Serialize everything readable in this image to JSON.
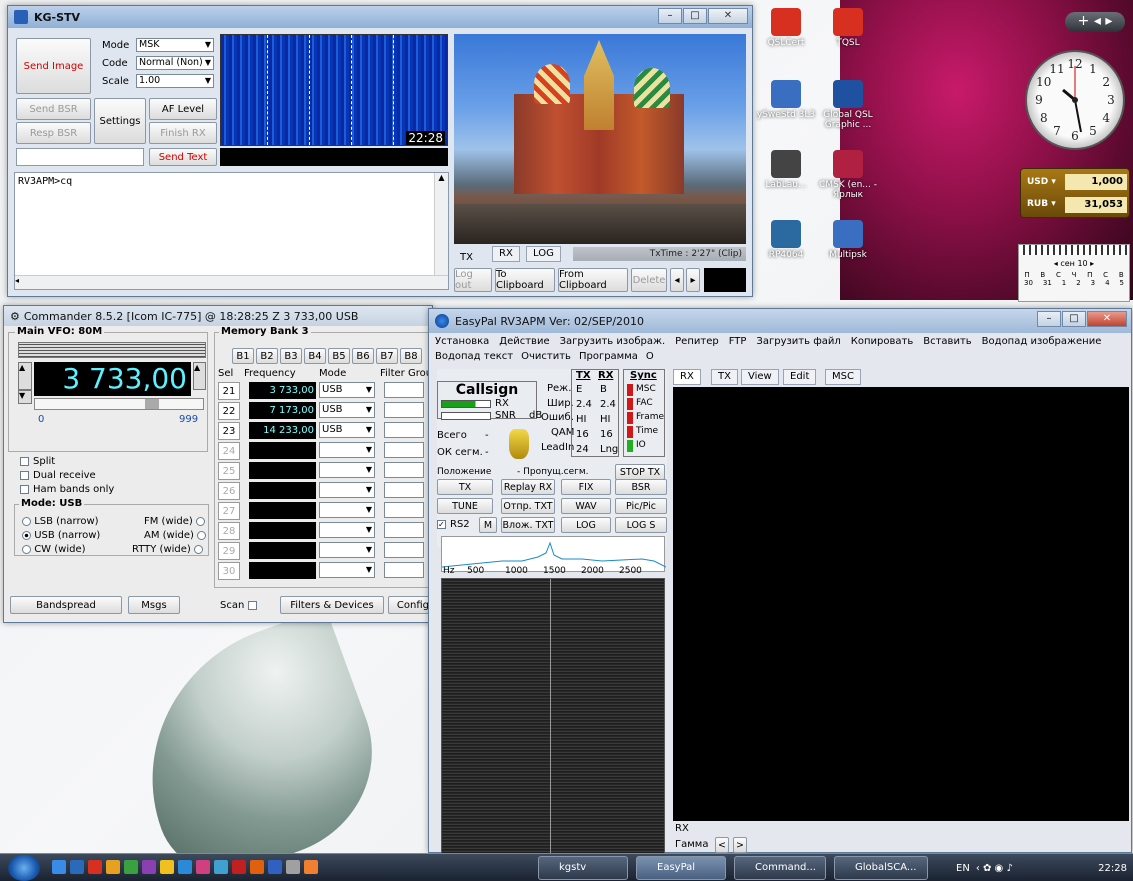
{
  "kgstv": {
    "title": "KG-STV",
    "send_image": "Send Image",
    "mode_label": "Mode",
    "mode_value": "MSK",
    "code_label": "Code",
    "code_value": "Normal (Non)",
    "scale_label": "Scale",
    "scale_value": "1.00",
    "send_bsr": "Send BSR",
    "resp_bsr": "Resp BSR",
    "settings": "Settings",
    "af_level": "AF Level",
    "finish_rx": "Finish RX",
    "send_text": "Send Text",
    "waterfall_time": "22:28",
    "text_content": "RV3APM>cq",
    "tab_tx": "TX",
    "tab_rx": "RX",
    "tab_log": "LOG",
    "txtime": "TxTime : 2'27\" (Clip)",
    "log_out": "Log out",
    "to_clipboard": "To Clipboard",
    "from_clipboard": "From Clipboard",
    "delete": "Delete"
  },
  "commander": {
    "title": "Commander 8.5.2 [Icom IC-775] @ 18:28:25 Z  3 733,00 USB",
    "main_vfo": "Main VFO: 80M",
    "frequency": "3 733,00",
    "slider_min": "0",
    "slider_max": "999",
    "split": "Split",
    "dual_receive": "Dual receive",
    "ham_bands_only": "Ham bands only",
    "mode_title": "Mode: USB",
    "lsb": "LSB (narrow)",
    "usb": "USB (narrow)",
    "cw": "CW (wide)",
    "fm": "FM (wide)",
    "am": "AM (wide)",
    "rtty": "RTTY (wide)",
    "memory_bank": "Memory Bank 3",
    "banks": [
      "B1",
      "B2",
      "B3",
      "B4",
      "B5",
      "B6",
      "B7",
      "B8"
    ],
    "col_sel": "Sel",
    "col_freq": "Frequency",
    "col_mode": "Mode",
    "col_fg": "Filter Group",
    "rows": [
      {
        "sel": "21",
        "freq": "3 733,00",
        "mode": "USB"
      },
      {
        "sel": "22",
        "freq": "7 173,00",
        "mode": "USB"
      },
      {
        "sel": "23",
        "freq": "14 233,00",
        "mode": "USB"
      },
      {
        "sel": "24",
        "freq": "",
        "mode": ""
      },
      {
        "sel": "25",
        "freq": "",
        "mode": ""
      },
      {
        "sel": "26",
        "freq": "",
        "mode": ""
      },
      {
        "sel": "27",
        "freq": "",
        "mode": ""
      },
      {
        "sel": "28",
        "freq": "",
        "mode": ""
      },
      {
        "sel": "29",
        "freq": "",
        "mode": ""
      },
      {
        "sel": "30",
        "freq": "",
        "mode": ""
      }
    ],
    "bandspread": "Bandspread",
    "msgs": "Msgs",
    "scan": "Scan",
    "filters_devices": "Filters & Devices",
    "config": "Config"
  },
  "easypal": {
    "title": "EasyPal  RV3APM  Ver: 02/SEP/2010",
    "menu": [
      "Установка",
      "Действие",
      "Загрузить изображ.",
      "Репитер",
      "FTP",
      "Загрузить файл",
      "Копировать",
      "Вставить",
      "Водопад изображение"
    ],
    "menu2": [
      "Водопад текст",
      "Очистить",
      "Программа",
      "О"
    ],
    "callsign": "Callsign",
    "rx": "RX",
    "snr": "SNR",
    "db": "dB",
    "rez": "Реж.",
    "shir": "Шир.",
    "oshib": "Ошиб.",
    "qam": "QAM",
    "leadin": "LeadIn",
    "col_tx": "TX",
    "col_rx": "RX",
    "vals_tx": [
      "E",
      "2.4",
      "HI",
      "16",
      "24"
    ],
    "vals_rx": [
      "B",
      "2.4",
      "HI",
      "16",
      "Lng"
    ],
    "sync": "Sync",
    "sync_items": [
      "MSC",
      "FAC",
      "Frame",
      "Time",
      "IO"
    ],
    "vsego": "Всего",
    "ok_segm": "ОК сегм.",
    "dash": "-",
    "polozhenie": "Положение",
    "propusch": "- Пропущ.сегм.",
    "stop_tx": "STOP TX",
    "b_tx": "TX",
    "b_replay": "Replay RX",
    "b_fix": "FIX",
    "b_bsr": "BSR",
    "b_tune": "TUNE",
    "b_otpr": "Отпр. TXT",
    "b_wav": "WAV",
    "b_picpic": "Pic/Pic",
    "b_rs2": "RS2",
    "b_m": "M",
    "b_vlozh": "Влож. TXT",
    "b_log": "LOG",
    "b_logs": "LOG S",
    "spec_hz": "Hz",
    "spec_ticks": [
      "500",
      "1000",
      "1500",
      "2000",
      "2500"
    ],
    "tabs": [
      "RX",
      "TX",
      "View",
      "Edit",
      "MSC"
    ],
    "status_rx": "RX",
    "gamma": "Гамма"
  },
  "desktop": {
    "icons": [
      {
        "label": "QSLCert",
        "color": "#d83020"
      },
      {
        "label": "TQSL",
        "color": "#d83020"
      },
      {
        "label": "ySweStd 3L3",
        "color": "#3a6ec0"
      },
      {
        "label": "Global QSL Graphic ...",
        "color": "#2050a0"
      },
      {
        "label": "LabLau...",
        "color": "#444444"
      },
      {
        "label": "CMSK (en... - Ярлык",
        "color": "#b02040"
      },
      {
        "label": "RP4064",
        "color": "#2a6aa0"
      },
      {
        "label": "Multipsk",
        "color": "#3a6ec0"
      }
    ],
    "usd_label": "USD",
    "usd_value": "1,000",
    "rub_label": "RUB",
    "rub_value": "31,053",
    "cal_month": "сен 10",
    "cal_days": [
      "П",
      "В",
      "С",
      "Ч",
      "П",
      "С",
      "В"
    ],
    "cal_row1": [
      "30",
      "31",
      "1",
      "2",
      "3",
      "4",
      "5"
    ],
    "clock_nums": [
      "12",
      "1",
      "2",
      "3",
      "4",
      "5",
      "6",
      "7",
      "8",
      "9",
      "10",
      "11"
    ]
  },
  "taskbar": {
    "tasks": [
      "kgstv",
      "EasyPal",
      "Command...",
      "GlobalSCA..."
    ],
    "lang": "EN",
    "time": "22:28"
  }
}
